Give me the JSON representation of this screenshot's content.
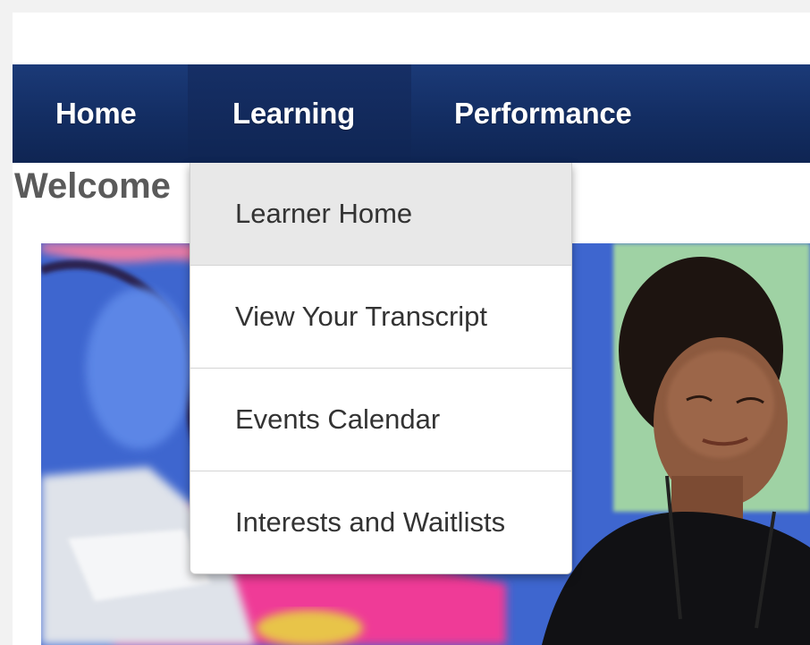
{
  "nav": {
    "items": [
      {
        "label": "Home"
      },
      {
        "label": "Learning"
      },
      {
        "label": "Performance"
      }
    ]
  },
  "dropdown": {
    "items": [
      {
        "label": "Learner Home",
        "active": true
      },
      {
        "label": "View Your Transcript"
      },
      {
        "label": "Events Calendar"
      },
      {
        "label": "Interests and Waitlists"
      }
    ]
  },
  "main": {
    "welcome_text": "Welcome"
  },
  "colors": {
    "navbar": "#132d62",
    "active_item_bg": "#e8e8e8",
    "welcome_text": "#5a5a5a"
  }
}
